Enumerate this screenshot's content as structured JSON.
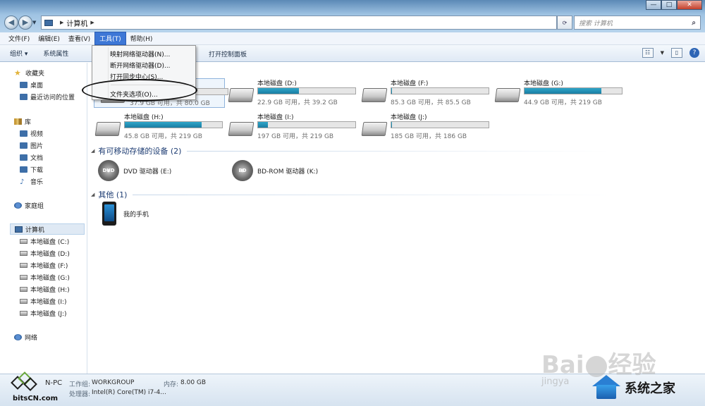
{
  "window": {
    "address_path": "计算机",
    "search_placeholder": "搜索 计算机",
    "caption": {
      "minimize": "—",
      "maximize": "□",
      "close": "✕"
    }
  },
  "menubar": {
    "items": [
      "文件(F)",
      "编辑(E)",
      "查看(V)",
      "工具(T)",
      "帮助(H)"
    ],
    "active": "工具(T)"
  },
  "toolbar": {
    "organize": "组织 ▾",
    "system_props": "系统属性",
    "control_panel": "打开控制面板"
  },
  "tools_menu": {
    "items": [
      "映射网络驱动器(N)...",
      "断开网络驱动器(D)...",
      "打开同步中心(S)...",
      "文件夹选项(O)..."
    ]
  },
  "sidebar": {
    "favorites": "收藏夹",
    "desktop": "桌面",
    "recent": "最近访问的位置",
    "libraries": "库",
    "videos": "视频",
    "pictures": "图片",
    "documents": "文档",
    "downloads": "下载",
    "music": "音乐",
    "homegroup": "家庭组",
    "computer": "计算机",
    "drives": [
      "本地磁盘 (C:)",
      "本地磁盘 (D:)",
      "本地磁盘 (F:)",
      "本地磁盘 (G:)",
      "本地磁盘 (H:)",
      "本地磁盘 (I:)",
      "本地磁盘 (J:)"
    ],
    "network": "网络"
  },
  "content": {
    "drives": [
      {
        "name": "",
        "stat": "37.9 GB 可用，共 80.0 GB",
        "used_fraction": 0.53
      },
      {
        "name": "本地磁盘 (D:)",
        "stat": "22.9 GB 可用，共 39.2 GB",
        "used_fraction": 0.42
      },
      {
        "name": "本地磁盘 (F:)",
        "stat": "85.3 GB 可用，共 85.5 GB",
        "used_fraction": 0.01
      },
      {
        "name": "本地磁盘 (G:)",
        "stat": "44.9 GB 可用，共 219 GB",
        "used_fraction": 0.79
      },
      {
        "name": "本地磁盘 (H:)",
        "stat": "45.8 GB 可用，共 219 GB",
        "used_fraction": 0.79
      },
      {
        "name": "本地磁盘 (I:)",
        "stat": "197 GB 可用，共 219 GB",
        "used_fraction": 0.1
      },
      {
        "name": "本地磁盘 (J:)",
        "stat": "185 GB 可用，共 186 GB",
        "used_fraction": 0.01
      }
    ],
    "removable_group": "有可移动存储的设备 (2)",
    "dvd_label": "DVD 驱动器 (E:)",
    "dvd_badge": "DVD",
    "bd_label": "BD-ROM 驱动器 (K:)",
    "bd_badge": "BD",
    "other_group": "其他 (1)",
    "phone_label": "我的手机"
  },
  "status": {
    "pc_name_partial": "N-PC",
    "workgroup_key": "工作组:",
    "workgroup_val": "WORKGROUP",
    "memory_key": "内存:",
    "memory_val": "8.00 GB",
    "cpu_key": "处理器:",
    "cpu_val": "Intel(R) Core(TM) i7-4..."
  },
  "watermarks": {
    "bits": "bitsCN.com",
    "baidu_left": "Bai",
    "baidu_right": "经验",
    "jingyan": "jingya",
    "xtzj": "系统之家"
  }
}
